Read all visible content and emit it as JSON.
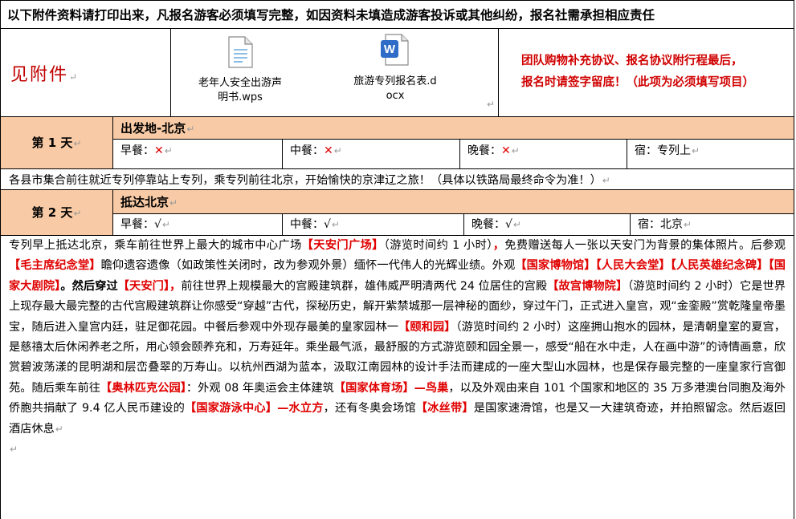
{
  "notice": "以下附件资料请打印出来，凡报名游客必须填写完整，如因资料未填造成游客投诉或其他纠纷，报名社需承担相应责任",
  "attachments": {
    "see_label": "见附件",
    "files": [
      {
        "name_line1": "老年人安全出游声",
        "name_line2": "明书.wps",
        "icon": "document-icon"
      },
      {
        "name_line1": "旅游专列报名表.d",
        "name_line2": "ocx",
        "icon": "word-doc-icon"
      }
    ],
    "note_line1": "团队购物补充协议、报名协议附行程最后，",
    "note_line2": "报名时请签字留底！（此项为必须填写项目）"
  },
  "days": [
    {
      "label": "第 1 天",
      "title": "出发地-北京",
      "breakfast_label": "早餐：",
      "breakfast": "✕",
      "lunch_label": "中餐：",
      "lunch": "✕",
      "dinner_label": "晚餐：",
      "dinner": "✕",
      "stay_label": "宿：",
      "stay": "专列上",
      "desc": "各县市集合前往就近专列停靠站上专列，乘专列前往北京，开始愉快的京津辽之旅！（具体以铁路局最终命令为准！）"
    },
    {
      "label": "第 2 天",
      "title": "抵达北京",
      "breakfast_label": "早餐：",
      "breakfast": "√",
      "lunch_label": "中餐：",
      "lunch": "√",
      "dinner_label": "晚餐：",
      "dinner": "√",
      "stay_label": "宿：",
      "stay": "北京"
    }
  ],
  "day2_body": {
    "t1": "专列早上抵达北京，乘车前往世界上最大的城市中心广场",
    "h1": "【天安门广场】",
    "t2": "（游览时间约 1 小时）",
    "h2": "，",
    "t3": "免费赠送每人一张以天安门为背景的集体照片。后参观",
    "h3": "【毛主席纪念堂】",
    "t4": "瞻仰遗容遗像（如政策性关闭时，改为参观外景）缅怀一代伟人的光辉业绩。外观",
    "h4": "【国家博物馆】【人民大会堂】【人民英雄纪念碑】【国家大剧院】",
    "b1": "。然后穿过",
    "h5": "【天安门】，",
    "t5": "前往世界上规模最大的宫殿建筑群，雄伟威严明清两代 24 位居住的宫殿",
    "h6": "【故宫博物院】",
    "t6": "（游览时间约 2 小时）它是世界上现存最大最完整的古代宫殿建筑群让你感受“穿越”古代，探秘历史，解开紫禁城那一层神秘的面纱，穿过午门，正式进入皇宫，观“金銮殿”赏乾隆皇帝墨宝，随后进入皇宫内廷，驻足御花园。中餐后参观中外现存最美的皇家园林一",
    "h7": "【颐和园】",
    "t7": "（游览时间约 2 小时）这座拥山抱水的园林，是清朝皇室的夏宫，是慈禧太后休闲养老之所，用心领会颐养充和，万寿延年。乘坐最气派，最舒服的方式游览颐和园全景一，感受“船在水中走，人在画中游”的诗情画意，欣赏碧波荡漾的昆明湖和层峦叠翠的万寿山。以杭州西湖为蓝本，汲取江南园林的设计手法而建成的一座大型山水园林，也是保存最完整的一座皇家行宫御苑。随后乘车前往",
    "h8": "【奥林匹克公园】",
    "t8": "：外观 08 年奥运会主体建筑",
    "h9": "【国家体育场】—鸟巢",
    "t9": "，以及外观由来自 101 个国家和地区的 35 万多港澳台同胞及海外侨胞共捐献了 9.4 亿人民币建设的",
    "h10": "【国家游泳中心】—水立方",
    "t10": "，还有冬奥会场馆",
    "h11": "【冰丝带】",
    "t11": "是国家速滑馆，也是又一大建筑奇迹，并拍照留念。然后返回酒店休息"
  },
  "paragraph_mark": "↵",
  "colors": {
    "accent_red": "#e00000",
    "day_header_bg": "#f8cba6"
  }
}
